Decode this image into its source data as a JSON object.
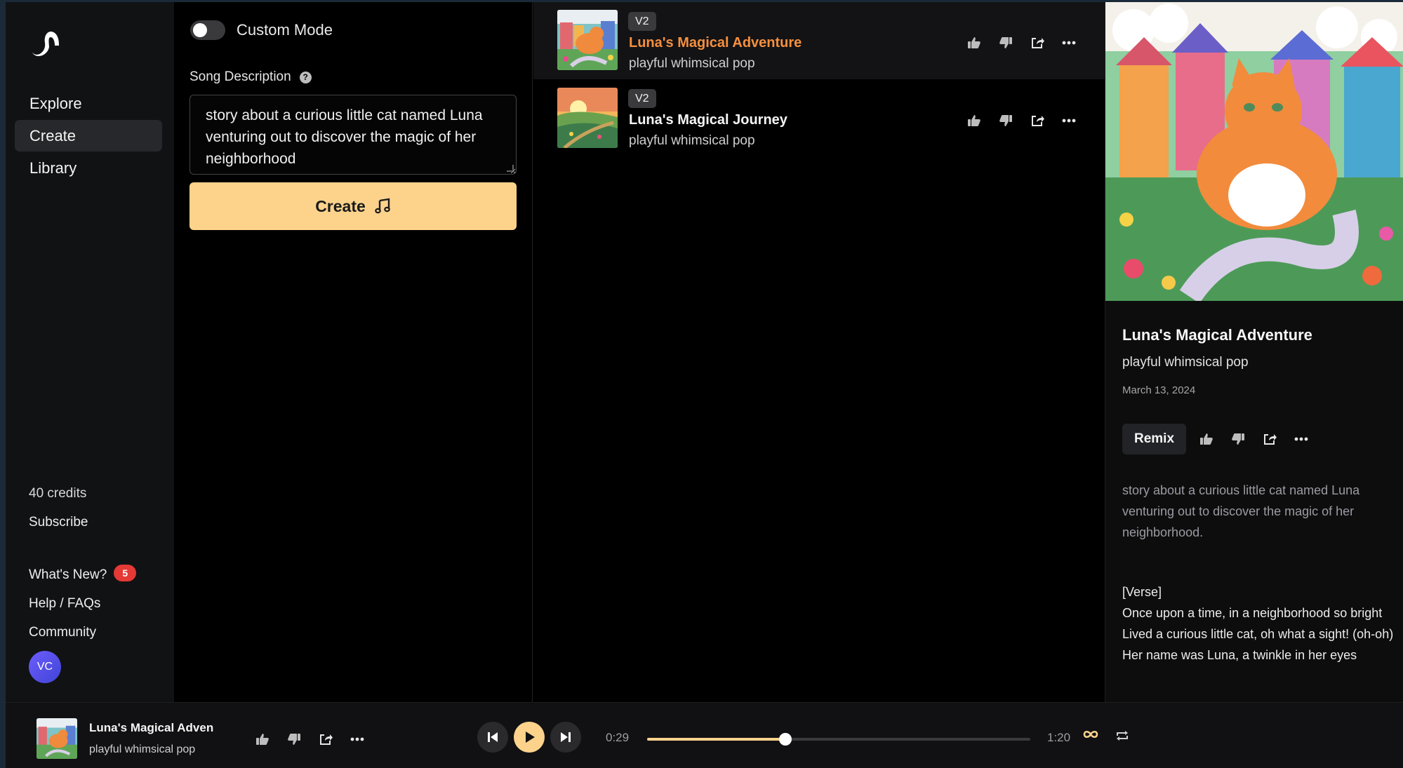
{
  "sidebar": {
    "nav": [
      {
        "label": "Explore"
      },
      {
        "label": "Create"
      },
      {
        "label": "Library"
      }
    ],
    "credits": "40 credits",
    "subscribe": "Subscribe",
    "whats_new": "What's New?",
    "whats_new_count": "5",
    "help": "Help / FAQs",
    "community": "Community",
    "avatar_initials": "VC"
  },
  "create": {
    "custom_mode_label": "Custom Mode",
    "description_label": "Song Description",
    "description_value": "story about a curious little cat named Luna venturing out to discover the magic of her neighborhood",
    "create_button": "Create"
  },
  "songs": [
    {
      "version": "V2",
      "title": "Luna's Magical Adventure",
      "genre": "playful whimsical pop"
    },
    {
      "version": "V2",
      "title": "Luna's Magical Journey",
      "genre": "playful whimsical pop"
    }
  ],
  "detail": {
    "title": "Luna's Magical Adventure",
    "genre": "playful whimsical pop",
    "date": "March 13, 2024",
    "remix_label": "Remix",
    "prompt": "story about a curious little cat named Luna venturing out to discover the magic of her neighborhood.",
    "lyrics": [
      "[Verse]",
      "Once upon a time, in a neighborhood so bright",
      "Lived a curious little cat, oh what a sight! (oh-oh)",
      "Her name was Luna, a twinkle in her eyes"
    ]
  },
  "player": {
    "title": "Luna's Magical Adven",
    "genre": "playful whimsical pop",
    "elapsed": "0:29",
    "duration": "1:20",
    "progress": 0.36
  },
  "colors": {
    "accent": "#fdd38c",
    "highlight_title": "#f6903f",
    "badge": "#e53935"
  }
}
